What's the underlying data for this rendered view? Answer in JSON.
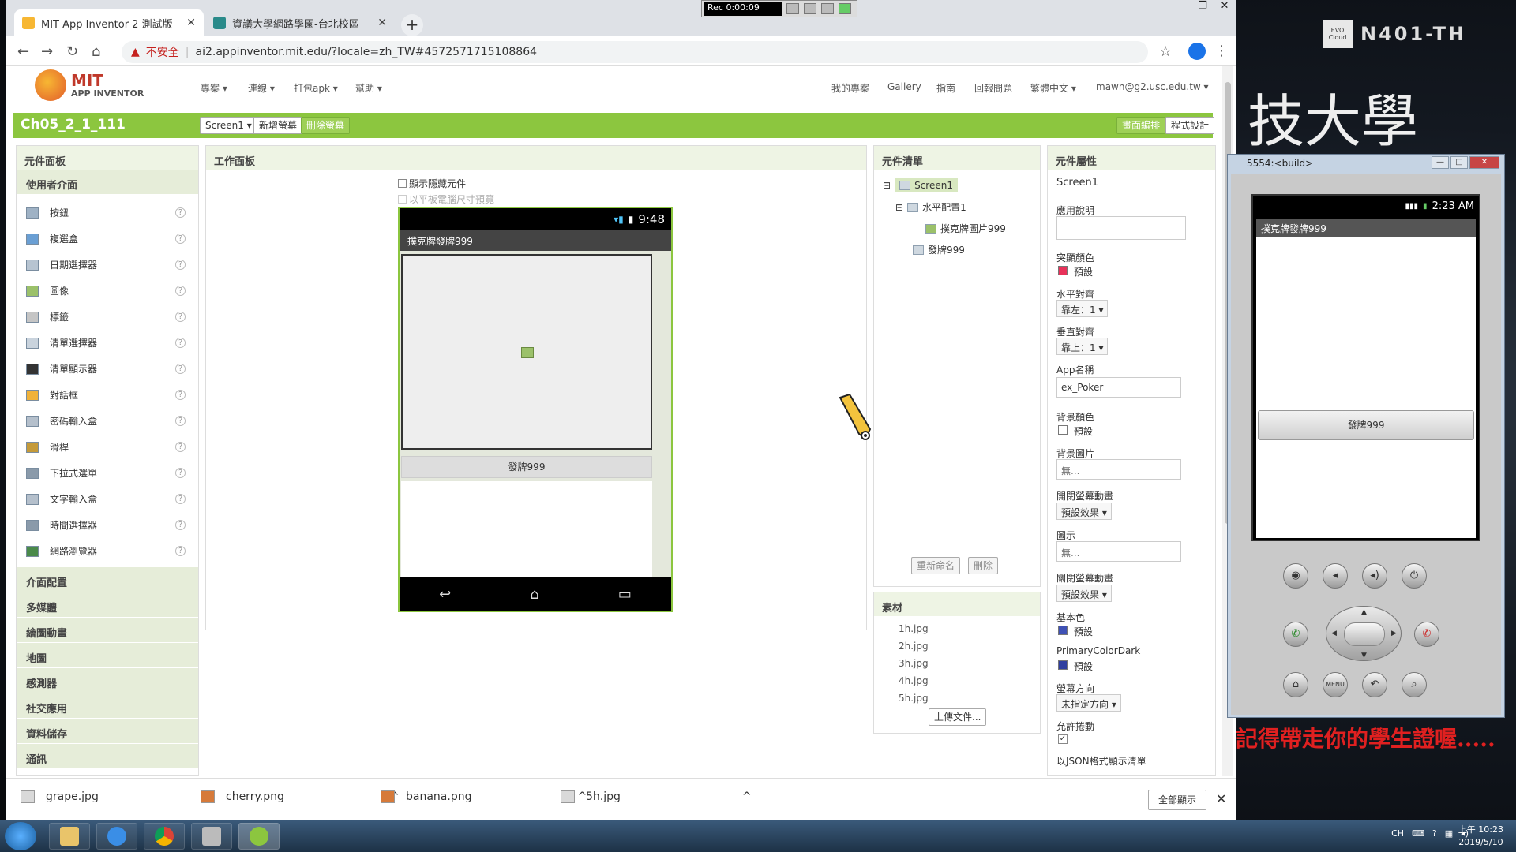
{
  "recorder": {
    "time": "Rec 0:00:09"
  },
  "browser": {
    "tabs": [
      {
        "title": "MIT App Inventor 2 測試版",
        "close": "✕"
      },
      {
        "title": "資議大學網路學園-台北校區",
        "close": "✕"
      }
    ],
    "new_tab": "+",
    "security_warning": "不安全",
    "url": "ai2.appinventor.mit.edu/?locale=zh_TW#4572571715108864",
    "window_buttons": [
      "—",
      "❐",
      "✕"
    ]
  },
  "ai_header": {
    "logo_main": "MIT",
    "logo_sub": "APP INVENTOR",
    "menu_left": [
      "專案 ▾",
      "連線 ▾",
      "打包apk ▾",
      "幫助 ▾"
    ],
    "menu_right": [
      "我的專案",
      "Gallery",
      "指南",
      "回報問題",
      "繁體中文 ▾",
      "mawn@g2.usc.edu.tw ▾"
    ]
  },
  "project_bar": {
    "title": "Ch05_2_1_111",
    "screen_select": "Screen1 ▾",
    "add_screen": "新增螢幕",
    "remove_screen": "刪除螢幕",
    "designer": "畫面編排",
    "blocks": "程式設計"
  },
  "palette": {
    "header": "元件面板",
    "open_category": "使用者介面",
    "items": [
      "按鈕",
      "複選盒",
      "日期選擇器",
      "圖像",
      "標籤",
      "清單選擇器",
      "清單顯示器",
      "對話框",
      "密碼輸入盒",
      "滑桿",
      "下拉式選單",
      "文字輸入盒",
      "時間選擇器",
      "網路瀏覽器"
    ],
    "help": "?",
    "categories": [
      "介面配置",
      "多媒體",
      "繪圖動畫",
      "地圖",
      "感測器",
      "社交應用",
      "資料儲存",
      "通訊"
    ]
  },
  "viewer": {
    "header": "工作面板",
    "show_hidden": "顯示隱藏元件",
    "tablet_preview": "以平板電腦尺寸預覽",
    "phone_time": "9:48",
    "screen_title": "撲克牌發牌999",
    "button_text": "發牌999"
  },
  "components": {
    "header": "元件清單",
    "tree": [
      {
        "name": "Screen1",
        "toggle": "⊟"
      },
      {
        "name": "水平配置1",
        "toggle": "⊟"
      },
      {
        "name": "撲克牌圖片999",
        "toggle": ""
      },
      {
        "name": "發牌999",
        "toggle": ""
      }
    ],
    "rename": "重新命名",
    "delete": "刪除"
  },
  "media": {
    "header": "素材",
    "files": [
      "1h.jpg",
      "2h.jpg",
      "3h.jpg",
      "4h.jpg",
      "5h.jpg"
    ],
    "upload": "上傳文件..."
  },
  "properties": {
    "header": "元件屬性",
    "component": "Screen1",
    "about_label": "應用說明",
    "accent_label": "突顯顏色",
    "accent_value": "預設",
    "halign_label": "水平對齊",
    "halign_value": "靠左：1 ▾",
    "valign_label": "垂直對齊",
    "valign_value": "靠上：1 ▾",
    "appname_label": "App名稱",
    "appname_value": "ex_Poker",
    "bgcolor_label": "背景顏色",
    "bgcolor_value": "預設",
    "bgimage_label": "背景圖片",
    "bgimage_value": "無...",
    "openanim_label": "開閉螢幕動畫",
    "openanim_value": "預設效果 ▾",
    "icon_label": "圖示",
    "icon_value": "無...",
    "closeanim_label": "關閉螢幕動畫",
    "closeanim_value": "預設效果 ▾",
    "primary_label": "基本色",
    "primary_value": "預設",
    "primarydark_label": "PrimaryColorDark",
    "primarydark_value": "預設",
    "orientation_label": "螢幕方向",
    "orientation_value": "未指定方向 ▾",
    "scroll_label": "允許捲動",
    "json_label": "以JSON格式顯示清單"
  },
  "downloads": {
    "items": [
      "grape.jpg",
      "cherry.png",
      "banana.png",
      "5h.jpg"
    ],
    "caret": "^",
    "show_all": "全部顯示",
    "close": "✕"
  },
  "emulator": {
    "title": "5554:<build>",
    "time": "2:23 AM",
    "app_title": "撲克牌發牌999",
    "button_text": "發牌999",
    "menu_label": "MENU"
  },
  "overlay": {
    "brand_logo": "EVO Cloud",
    "brand": "N401-TH",
    "calligraphy": "技大學",
    "banner": "記得帶走你的學生證喔....."
  },
  "taskbar": {
    "lang": "CH",
    "time": "上午 10:23",
    "date": "2019/5/10"
  },
  "colors": {
    "ai_green": "#8cc63f",
    "accent": "#e8325a",
    "primary": "#3f51b5",
    "primary_dark": "#303f9f",
    "banner_red": "#e02020"
  }
}
